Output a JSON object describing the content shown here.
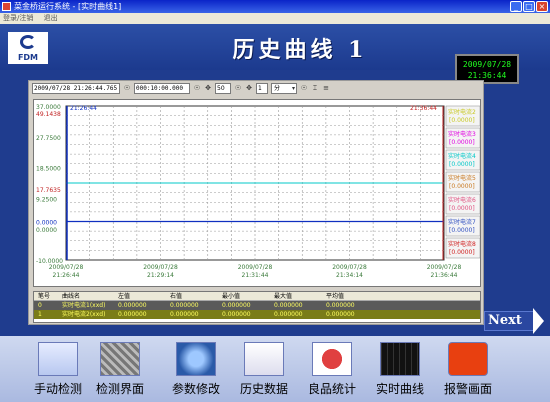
{
  "window": {
    "title": "菜金桥运行系统 - [实时曲线1]",
    "min_label": "_",
    "max_label": "□",
    "close_label": "×"
  },
  "menu": {
    "items": [
      "登录/注销",
      "退出"
    ]
  },
  "header": {
    "logo_text": "FDM",
    "title": "历史曲线  1",
    "date": "2009/07/28",
    "time": "21:36:44"
  },
  "toolbar": {
    "start_time": "2009/07/28 21:26:44.765",
    "span": "000:10:00.000",
    "percent": "50",
    "step_value": "1",
    "unit": "分"
  },
  "chart_data": {
    "type": "line",
    "y_ticks": [
      "37.0000",
      "27.7500",
      "18.5000",
      "9.2500",
      "0.0000",
      "-10.0000"
    ],
    "y_left_marks": [
      "49.1438",
      "17.7635",
      "0.0000"
    ],
    "x_ticks": [
      {
        "date": "2009/07/28",
        "time": "21:26:44"
      },
      {
        "date": "2009/07/28",
        "time": "21:29:14"
      },
      {
        "date": "2009/07/28",
        "time": "21:31:44"
      },
      {
        "date": "2009/07/28",
        "time": "21:34:14"
      },
      {
        "date": "2009/07/28",
        "time": "21:36:44"
      }
    ],
    "cursor_left_time": "21:26:44",
    "cursor_right_time": "21:36:44",
    "legend": [
      {
        "name": "实时电流2",
        "value": "[0.0000]",
        "color": "#c8c820"
      },
      {
        "name": "实时电流3",
        "value": "[0.0000]",
        "color": "#e000e0"
      },
      {
        "name": "实时电流4",
        "value": "[0.0000]",
        "color": "#00c8c8"
      },
      {
        "name": "实时电流5",
        "value": "[0.0000]",
        "color": "#c87820"
      },
      {
        "name": "实时电流6",
        "value": "[0.0000]",
        "color": "#e05080"
      },
      {
        "name": "实时电流7",
        "value": "[0.0000]",
        "color": "#3050c0"
      },
      {
        "name": "实时电流8",
        "value": "[0.0000]",
        "color": "#d02020"
      }
    ]
  },
  "table": {
    "headers": [
      "笔号",
      "曲线名",
      "左值",
      "右值",
      "最小值",
      "最大值",
      "平均值"
    ],
    "rows": [
      [
        "0",
        "实时电流1(xxd)",
        "0.000000",
        "0.000000",
        "0.000000",
        "0.000000",
        "0.000000"
      ],
      [
        "1",
        "实时电流2(xxd)",
        "0.000000",
        "0.000000",
        "0.000000",
        "0.000000",
        "0.000000"
      ]
    ]
  },
  "next_label": "Next",
  "nav": [
    {
      "label": "手动检测",
      "icon": "manual-check-icon"
    },
    {
      "label": "检测界面",
      "icon": "detect-screen-icon"
    },
    {
      "label": "参数修改",
      "icon": "parameter-icon"
    },
    {
      "label": "历史数据",
      "icon": "history-data-icon"
    },
    {
      "label": "良品统计",
      "icon": "pie-chart-icon"
    },
    {
      "label": "实时曲线",
      "icon": "realtime-curve-icon"
    },
    {
      "label": "报警画面",
      "icon": "alarm-icon"
    }
  ]
}
